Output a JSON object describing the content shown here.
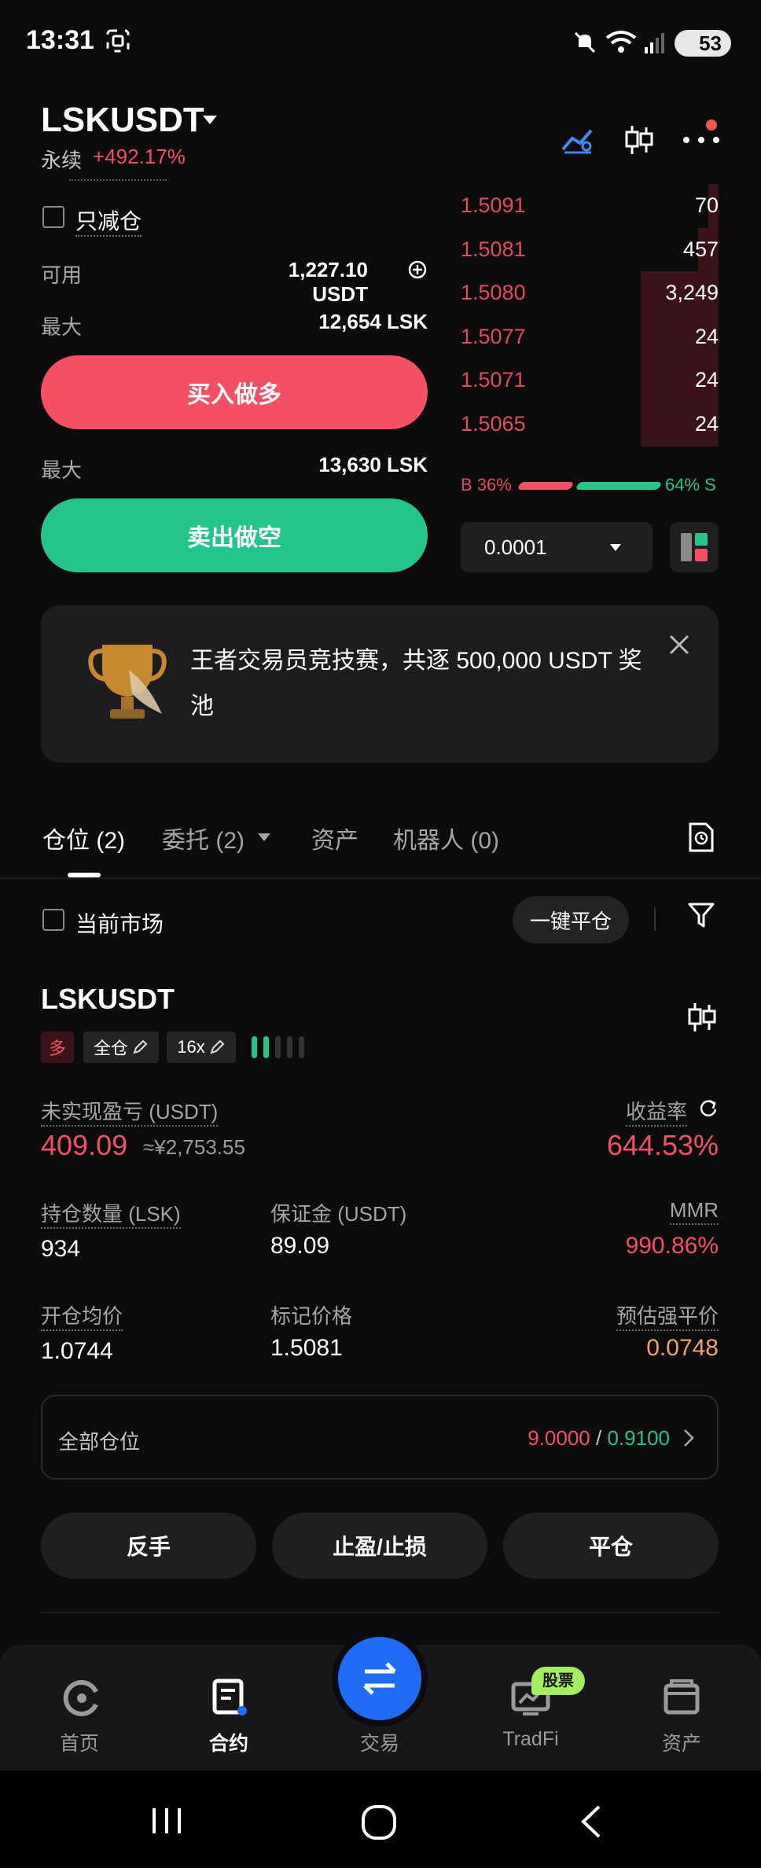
{
  "status_bar": {
    "time": "13:31",
    "battery": "53"
  },
  "header": {
    "symbol": "LSKUSDT",
    "type": "永续",
    "change": "+492.17%"
  },
  "form": {
    "reduce_only": "只减仓",
    "available_label": "可用",
    "available_value": "1,227.10 USDT",
    "max_label": "最大",
    "max_buy": "12,654 LSK",
    "buy_button": "买入做多",
    "max_sell": "13,630 LSK",
    "sell_button": "卖出做空"
  },
  "orderbook": {
    "asks": [
      {
        "price": "1.5091",
        "qty": "70",
        "depth": 0.04
      },
      {
        "price": "1.5081",
        "qty": "457",
        "depth": 0.08
      },
      {
        "price": "1.5080",
        "qty": "3,249",
        "depth": 0.3
      },
      {
        "price": "1.5077",
        "qty": "24",
        "depth": 0.3
      },
      {
        "price": "1.5071",
        "qty": "24",
        "depth": 0.3
      },
      {
        "price": "1.5065",
        "qty": "24",
        "depth": 0.3
      }
    ],
    "buy_ratio": "B 36%",
    "sell_ratio": "64% S",
    "precision": "0.0001"
  },
  "banner": {
    "text": "王者交易员竞技赛，共逐 500,000 USDT 奖池"
  },
  "tabs": {
    "positions": "仓位 (2)",
    "orders": "委托 (2)",
    "assets": "资产",
    "bots": "机器人 (0)"
  },
  "filter": {
    "current_market": "当前市场",
    "close_all": "一键平仓"
  },
  "position": {
    "symbol": "LSKUSDT",
    "side": "多",
    "margin_mode": "全仓",
    "leverage": "16x",
    "unrealized_label": "未实现盈亏 (USDT)",
    "unrealized_value": "409.09",
    "unrealized_cny": "≈¥2,753.55",
    "roe_label": "收益率",
    "roe_value": "644.53%",
    "size_label": "持仓数量 (LSK)",
    "size_value": "934",
    "margin_label": "保证金 (USDT)",
    "margin_value": "89.09",
    "mmr_label": "MMR",
    "mmr_value": "990.86%",
    "entry_label": "开仓均价",
    "entry_value": "1.0744",
    "mark_label": "标记价格",
    "mark_value": "1.5081",
    "liq_label": "预估强平价",
    "liq_value": "0.0748",
    "all_positions_label": "全部仓位",
    "all_positions_tp": "9.0000",
    "all_positions_sep": "/",
    "all_positions_sl": "0.9100",
    "reverse": "反手",
    "tpsl": "止盈/止损",
    "close": "平仓"
  },
  "nav": {
    "home": "首页",
    "futures": "合约",
    "trade": "交易",
    "tradfi": "TradFi",
    "tradfi_tag": "股票",
    "assets": "资产"
  }
}
